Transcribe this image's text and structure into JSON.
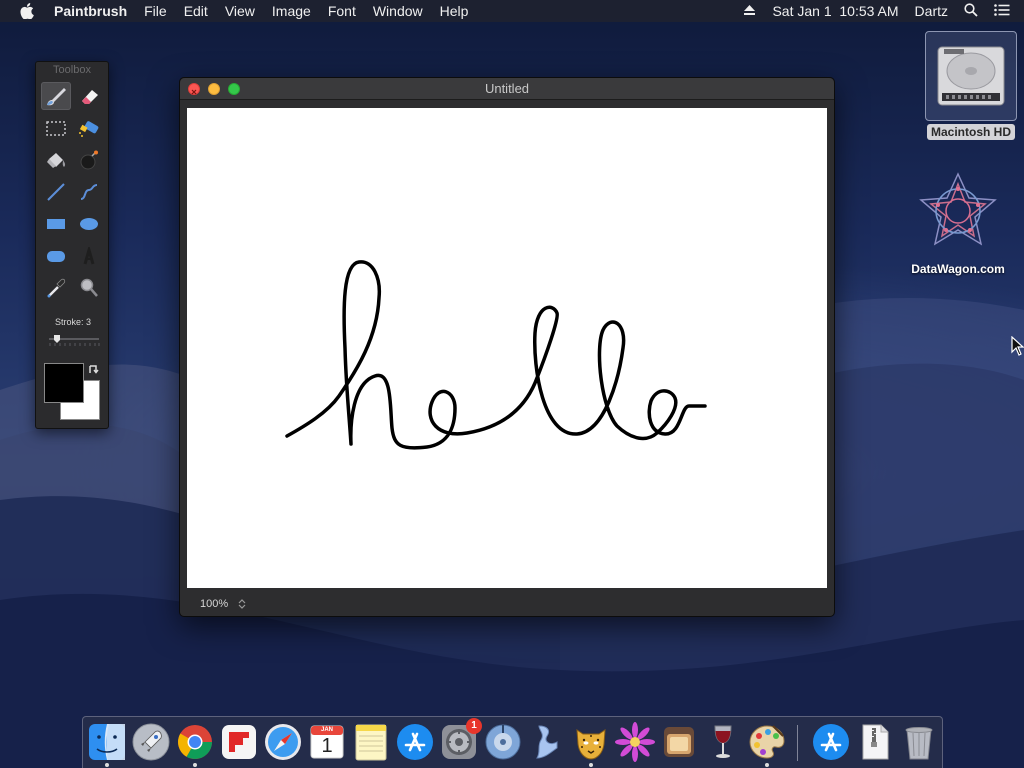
{
  "menubar": {
    "app_name": "Paintbrush",
    "menus": [
      "File",
      "Edit",
      "View",
      "Image",
      "Font",
      "Window",
      "Help"
    ],
    "clock": "Sat Jan 1  10:53 AM",
    "user": "Dartz",
    "icons": [
      "apple-icon",
      "eject-icon",
      "spotlight-search-icon",
      "notification-center-icon"
    ]
  },
  "toolbox": {
    "title": "Toolbox",
    "tools": [
      {
        "name": "paintbrush-tool",
        "selected": true
      },
      {
        "name": "eraser-tool",
        "selected": false
      },
      {
        "name": "selection-tool",
        "selected": false
      },
      {
        "name": "spray-can-tool",
        "selected": false
      },
      {
        "name": "paint-bucket-tool",
        "selected": false
      },
      {
        "name": "bomb-tool",
        "selected": false
      },
      {
        "name": "line-tool",
        "selected": false
      },
      {
        "name": "curve-tool",
        "selected": false
      },
      {
        "name": "rectangle-tool",
        "selected": false
      },
      {
        "name": "ellipse-tool",
        "selected": false
      },
      {
        "name": "rounded-rectangle-tool",
        "selected": false
      },
      {
        "name": "text-tool",
        "selected": false
      },
      {
        "name": "eyedropper-tool",
        "selected": false
      },
      {
        "name": "zoom-tool",
        "selected": false
      }
    ],
    "stroke_label": "Stroke: 3",
    "stroke_value": 3,
    "foreground_color": "#000000",
    "background_color": "#ffffff"
  },
  "document": {
    "title": "Untitled",
    "zoom": "100%"
  },
  "desktop": {
    "icons": [
      {
        "label": "Macintosh HD",
        "icon": "hard-drive-icon"
      },
      {
        "label": "DataWagon.com",
        "icon": "geometric-star-icon"
      }
    ]
  },
  "dock": {
    "items": [
      {
        "name": "finder",
        "running": true
      },
      {
        "name": "launchpad",
        "running": false
      },
      {
        "name": "chrome",
        "running": true
      },
      {
        "name": "flipboard",
        "running": false
      },
      {
        "name": "safari",
        "running": false
      },
      {
        "name": "calendar",
        "running": false,
        "month": "JAN",
        "day": "1"
      },
      {
        "name": "notes",
        "running": false
      },
      {
        "name": "app-store",
        "running": false
      },
      {
        "name": "system-preferences",
        "running": false,
        "badge": "1"
      },
      {
        "name": "disk-utility",
        "running": false
      },
      {
        "name": "script-editor",
        "running": false
      },
      {
        "name": "paintbrush",
        "running": true
      },
      {
        "name": "flower-app",
        "running": false
      },
      {
        "name": "toast",
        "running": false
      },
      {
        "name": "wine",
        "running": false
      },
      {
        "name": "palette-app",
        "running": true
      },
      {
        "name": "app-store-2",
        "running": false
      },
      {
        "name": "archive-file",
        "running": false
      },
      {
        "name": "trash",
        "running": false
      }
    ]
  }
}
